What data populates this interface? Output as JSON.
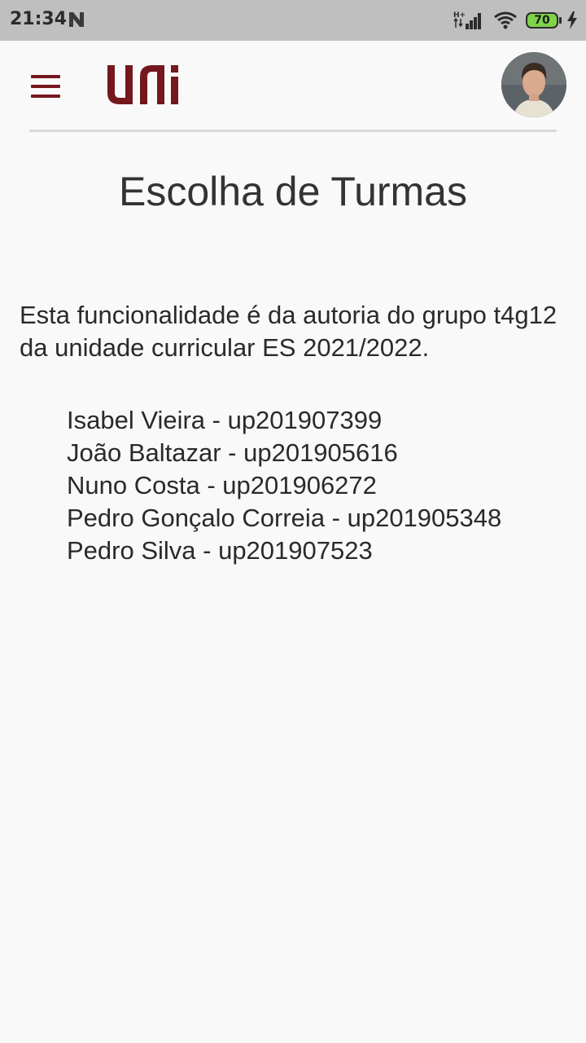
{
  "status_bar": {
    "time": "21:34",
    "network": "H+",
    "battery": "70"
  },
  "app": {
    "logo_text": "uni"
  },
  "page": {
    "title": "Escolha de Turmas",
    "description": "Esta funcionalidade é da autoria do grupo t4g12 da unidade curricular ES 2021/2022.",
    "members": [
      "Isabel Vieira - up201907399",
      "João Baltazar - up201905616",
      "Nuno Costa - up201906272",
      "Pedro Gonçalo Correia - up201905348",
      "Pedro Silva - up201907523"
    ]
  },
  "colors": {
    "brand": "#75171e",
    "background": "#f9f9f9",
    "status_bar": "#bfbfbf"
  }
}
